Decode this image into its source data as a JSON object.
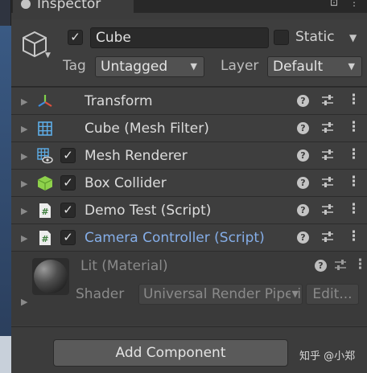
{
  "tab": {
    "title": "Inspector"
  },
  "gameobject": {
    "active": true,
    "name": "Cube",
    "static_checked": false,
    "static_label": "Static",
    "tag_label": "Tag",
    "tag_value": "Untagged",
    "layer_label": "Layer",
    "layer_value": "Default"
  },
  "components": [
    {
      "label": "Transform",
      "icon": "transform-icon",
      "has_checkbox": false,
      "selected": false
    },
    {
      "label": "Cube (Mesh Filter)",
      "icon": "mesh-filter-icon",
      "has_checkbox": false,
      "selected": false
    },
    {
      "label": "Mesh Renderer",
      "icon": "mesh-renderer-icon",
      "has_checkbox": true,
      "checked": true,
      "selected": false
    },
    {
      "label": "Box Collider",
      "icon": "box-collider-icon",
      "has_checkbox": true,
      "checked": true,
      "selected": false
    },
    {
      "label": "Demo Test (Script)",
      "icon": "script-icon",
      "has_checkbox": true,
      "checked": true,
      "selected": false
    },
    {
      "label": "Camera Controller (Script)",
      "icon": "script-icon",
      "has_checkbox": true,
      "checked": true,
      "selected": true
    }
  ],
  "material": {
    "title": "Lit (Material)",
    "shader_label": "Shader",
    "shader_value": "Universal Render Pipeline/Lit",
    "edit_label": "Edit..."
  },
  "footer": {
    "add_component_label": "Add Component",
    "watermark": "知乎 @小郑"
  },
  "colors": {
    "panel_bg": "#3c3c3c",
    "selected_text": "#85aee8",
    "collider_green": "#8ed14b"
  }
}
